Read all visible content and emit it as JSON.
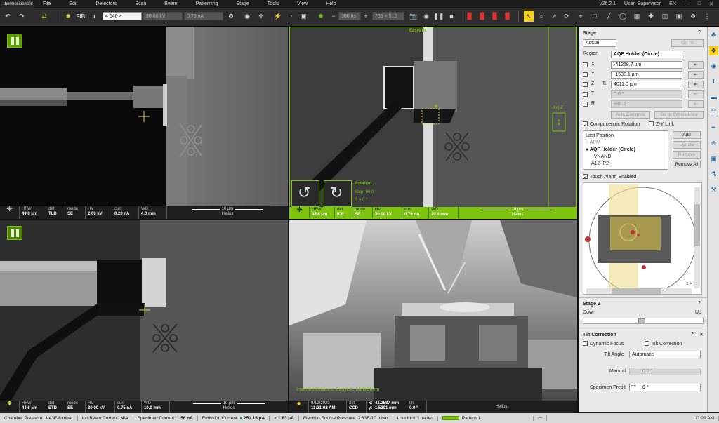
{
  "menubar": {
    "brand": "thermoscientific",
    "items": [
      "File",
      "Edit",
      "Detectors",
      "Scan",
      "Beam",
      "Patterning",
      "Stage",
      "Tools",
      "View",
      "Help"
    ],
    "version": "v26.2.1",
    "user": "User: Supervisor",
    "lang": "EN"
  },
  "toolbar": {
    "fibi": "FIBI",
    "mag": "4 646 ×",
    "hv": "30.00 kV",
    "curr": "0.75 nA",
    "dwell": "300 ns",
    "res": "768 × 512"
  },
  "quad1": {
    "hfw_l": "HFW",
    "hfw": "49.0 µm",
    "det_l": "det",
    "det": "TLD",
    "mode_l": "mode",
    "mode": "SE",
    "hv_l": "HV",
    "hv": "2.00 kV",
    "curr_l": "curr",
    "curr": "0.20 nA",
    "wd_l": "WD",
    "wd": "4.0 mm",
    "scale": "10 µm",
    "name": "Helios"
  },
  "quad2": {
    "easylift": "EasyLift",
    "jog": "Jog Z",
    "rotation": "Rotation",
    "step": "Step: 90.0 °",
    "r": "R = 0 °",
    "hfw_l": "HFW",
    "hfw": "44.6 µm",
    "det_l": "det",
    "det": "ICE",
    "mode_l": "mode",
    "mode": "SE",
    "hv_l": "HV",
    "hv": "30.00 kV",
    "curr_l": "curr",
    "curr": "0.75 nA",
    "wd_l": "WD",
    "wd": "10.0 mm",
    "scale": "10 µm",
    "name": "Helios"
  },
  "quad3": {
    "hfw_l": "HFW",
    "hfw": "44.6 µm",
    "det_l": "det",
    "det": "ETD",
    "mode_l": "mode",
    "mode": "SE",
    "hv_l": "HV",
    "hv": "30.00 kV",
    "curr_l": "curr",
    "curr": "0.75 nA",
    "wd_l": "WD",
    "wd": "10.0 mm",
    "scale": "10 µm",
    "name": "Helios"
  },
  "quad4": {
    "overlay": "Inserted Devices: EasyLift, MultiChem",
    "date": "9/12/2023",
    "time": "11:21:02 AM",
    "det_l": "det",
    "det": "CCD",
    "x": "x: -41.2587 mm",
    "y": "y: -1.5301 mm",
    "tilt_l": "tilt",
    "tilt": "0.0 °",
    "name": "Helios"
  },
  "panel": {
    "stage_title": "Stage",
    "coord": "Actual",
    "goto": "Go To",
    "region_l": "Region",
    "region": "AQF Holder (Circle)",
    "x_l": "X",
    "x": "-41258.7 µm",
    "y_l": "Y",
    "y": "-1530.1 µm",
    "z_l": "Z",
    "z": "4011.0 µm",
    "t_l": "T",
    "t": "0.0 °",
    "r_l": "R",
    "r": "180.0 °",
    "auto_eucentric": "Auto Eucentric",
    "goto_coin": "Go to Coincidence",
    "comp_rot": "Compucentric Rotation",
    "zy_link": "Z-Y Link",
    "positions": [
      "Last Position",
      "APM",
      "AQF Holder (Circle)",
      "_VNAND",
      "A12_P2"
    ],
    "add": "Add",
    "update": "Update",
    "remove": "Remove",
    "remove_all": "Remove All",
    "touch_alarm": "Touch Alarm Enabled",
    "map_zoom": "1 ×",
    "stagez_title": "Stage Z",
    "down": "Down",
    "up": "Up",
    "tilt_title": "Tilt Correction",
    "dyn_focus": "Dynamic Focus",
    "tilt_corr": "Tilt Correction",
    "tilt_angle_l": "Tilt Angle",
    "tilt_angle": "Automatic",
    "manual_l": "Manual",
    "manual": "0.0 °",
    "pretilt_l": "Specimen Pretilt",
    "pretilt": "0 °"
  },
  "status": {
    "chamber": "Chamber Pressure: 3.43E-6 mbar",
    "ion": "Ion Beam Current:",
    "ion_v": "N/A",
    "spec": "Specimen Current:",
    "spec_v": "1.56 nA",
    "emis": "Emission Current:",
    "emis_v": "251.15 µA",
    "ua": "1.83 µA",
    "esp": "Electron Source Pressure: 2.83E-10 mbar",
    "loadlock": "Loadlock: Loaded",
    "pattern": "Pattern 1",
    "clock": "11:21 AM"
  },
  "colors": {
    "accent_green": "#7dc40f",
    "panel_bg": "#e9e9e9"
  }
}
